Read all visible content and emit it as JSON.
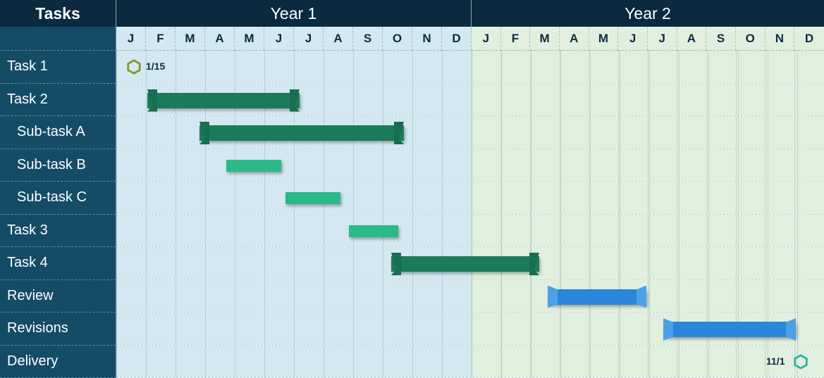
{
  "header": {
    "tasks_label": "Tasks",
    "year1_label": "Year 1",
    "year2_label": "Year 2"
  },
  "months": [
    "J",
    "F",
    "M",
    "A",
    "M",
    "J",
    "J",
    "A",
    "S",
    "O",
    "N",
    "D"
  ],
  "tasks": [
    {
      "label": "Task 1",
      "sub": false
    },
    {
      "label": "Task 2",
      "sub": false
    },
    {
      "label": "Sub-task A",
      "sub": true
    },
    {
      "label": "Sub-task B",
      "sub": true
    },
    {
      "label": "Sub-task C",
      "sub": true
    },
    {
      "label": "Task 3",
      "sub": false
    },
    {
      "label": "Task 4",
      "sub": false
    },
    {
      "label": "Review",
      "sub": false
    },
    {
      "label": "Revisions",
      "sub": false
    },
    {
      "label": "Delivery",
      "sub": false
    }
  ],
  "milestones": {
    "task1": {
      "date_label": "1/15",
      "color": "#8a8f2e"
    },
    "delivery": {
      "date_label": "11/1",
      "color": "#2bb0a0"
    }
  },
  "chart_data": {
    "type": "gantt",
    "title": "",
    "x_units": "months",
    "x_range": [
      "Year 1 Jan",
      "Year 2 Dec"
    ],
    "categories_year1": [
      "J",
      "F",
      "M",
      "A",
      "M",
      "J",
      "J",
      "A",
      "S",
      "O",
      "N",
      "D"
    ],
    "categories_year2": [
      "J",
      "F",
      "M",
      "A",
      "M",
      "J",
      "J",
      "A",
      "S",
      "O",
      "N",
      "D"
    ],
    "rows": [
      {
        "name": "Task 1",
        "type": "milestone",
        "date": "Y1-Jan-15",
        "label": "1/15"
      },
      {
        "name": "Task 2",
        "type": "bar",
        "style": "summary-dark-green",
        "start": "Y1-Feb",
        "end": "Y1-Jun"
      },
      {
        "name": "Sub-task A",
        "type": "bar",
        "style": "summary-dark-green",
        "start": "Y1-Mar",
        "end": "Y1-Oct"
      },
      {
        "name": "Sub-task B",
        "type": "bar",
        "style": "flat-green",
        "start": "Y1-Apr",
        "end": "Y1-May"
      },
      {
        "name": "Sub-task C",
        "type": "bar",
        "style": "flat-green",
        "start": "Y1-Jun",
        "end": "Y1-Jul"
      },
      {
        "name": "Task 3",
        "type": "bar",
        "style": "flat-green",
        "start": "Y1-Sep",
        "end": "Y1-Oct"
      },
      {
        "name": "Task 4",
        "type": "bar",
        "style": "summary-dark-green",
        "start": "Y1-Oct",
        "end": "Y2-Feb"
      },
      {
        "name": "Review",
        "type": "bar",
        "style": "summary-blue",
        "start": "Y2-Mar",
        "end": "Y2-Jun"
      },
      {
        "name": "Revisions",
        "type": "bar",
        "style": "summary-blue",
        "start": "Y2-Jul",
        "end": "Y2-Nov"
      },
      {
        "name": "Delivery",
        "type": "milestone",
        "date": "Y2-Nov-01",
        "label": "11/1"
      }
    ]
  }
}
